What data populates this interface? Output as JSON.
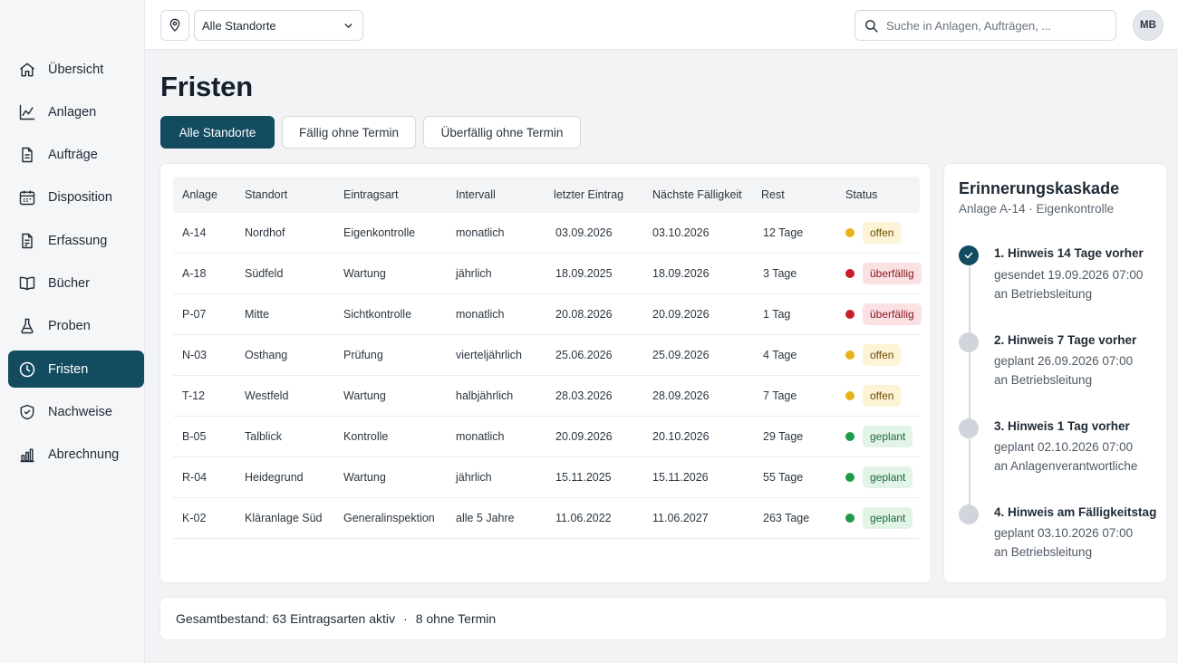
{
  "nav": {
    "items": [
      {
        "label": "Übersicht",
        "icon": "home-icon",
        "active": false
      },
      {
        "label": "Anlagen",
        "icon": "chart-line-icon",
        "active": false
      },
      {
        "label": "Aufträge",
        "icon": "document-icon",
        "active": false
      },
      {
        "label": "Disposition",
        "icon": "calendar-icon",
        "active": false
      },
      {
        "label": "Erfassung",
        "icon": "document-edit-icon",
        "active": false
      },
      {
        "label": "Bücher",
        "icon": "book-icon",
        "active": false
      },
      {
        "label": "Proben",
        "icon": "flask-icon",
        "active": false
      },
      {
        "label": "Fristen",
        "icon": "clock-icon",
        "active": true
      },
      {
        "label": "Nachweise",
        "icon": "shield-icon",
        "active": false
      },
      {
        "label": "Abrechnung",
        "icon": "bar-chart-icon",
        "active": false
      }
    ]
  },
  "topbar": {
    "location_value": "Alle Standorte",
    "search_placeholder": "Suche in Anlagen, Aufträgen, ...",
    "avatar_initials": "MB"
  },
  "page": {
    "title": "Fristen",
    "tabs": [
      {
        "label": "Alle Standorte",
        "active": true
      },
      {
        "label": "Fällig ohne Termin",
        "active": false
      },
      {
        "label": "Überfällig ohne Termin",
        "active": false
      }
    ]
  },
  "table": {
    "headers": [
      "Anlage",
      "Standort",
      "Eintragsart",
      "Intervall",
      "letzter Eintrag",
      "Nächste Fälligkeit",
      "Rest",
      "Status"
    ],
    "rows": [
      {
        "anlage": "A-14",
        "standort": "Nordhof",
        "eintragsart": "Eigenkontrolle",
        "intervall": "monatlich",
        "letzter": "03.09.2026",
        "naechste": "03.10.2026",
        "rest": "12 Tage",
        "status": "offen",
        "status_type": "open"
      },
      {
        "anlage": "A-18",
        "standort": "Südfeld",
        "eintragsart": "Wartung",
        "intervall": "jährlich",
        "letzter": "18.09.2025",
        "naechste": "18.09.2026",
        "rest": "3 Tage",
        "status": "überfällig",
        "status_type": "overdue"
      },
      {
        "anlage": "P-07",
        "standort": "Mitte",
        "eintragsart": "Sichtkontrolle",
        "intervall": "monatlich",
        "letzter": "20.08.2026",
        "naechste": "20.09.2026",
        "rest": "1 Tag",
        "status": "überfällig",
        "status_type": "overdue"
      },
      {
        "anlage": "N-03",
        "standort": "Osthang",
        "eintragsart": "Prüfung",
        "intervall": "vierteljährlich",
        "letzter": "25.06.2026",
        "naechste": "25.09.2026",
        "rest": "4 Tage",
        "status": "offen",
        "status_type": "open"
      },
      {
        "anlage": "T-12",
        "standort": "Westfeld",
        "eintragsart": "Wartung",
        "intervall": "halbjährlich",
        "letzter": "28.03.2026",
        "naechste": "28.09.2026",
        "rest": "7 Tage",
        "status": "offen",
        "status_type": "open"
      },
      {
        "anlage": "B-05",
        "standort": "Talblick",
        "eintragsart": "Kontrolle",
        "intervall": "monatlich",
        "letzter": "20.09.2026",
        "naechste": "20.10.2026",
        "rest": "29 Tage",
        "status": "geplant",
        "status_type": "planned"
      },
      {
        "anlage": "R-04",
        "standort": "Heidegrund",
        "eintragsart": "Wartung",
        "intervall": "jährlich",
        "letzter": "15.11.2025",
        "naechste": "15.11.2026",
        "rest": "55 Tage",
        "status": "geplant",
        "status_type": "planned"
      },
      {
        "anlage": "K-02",
        "standort": "Kläranlage Süd",
        "eintragsart": "Generalinspektion",
        "intervall": "alle 5 Jahre",
        "letzter": "11.06.2022",
        "naechste": "11.06.2027",
        "rest": "263 Tage",
        "status": "geplant",
        "status_type": "planned"
      }
    ]
  },
  "status_colors": {
    "open": {
      "dot": "#e8b21a",
      "bg": "#fdf3d6",
      "text": "#6b4e00"
    },
    "overdue": {
      "dot": "#c81e2c",
      "bg": "#fbe1e3",
      "text": "#8a1822"
    },
    "planned": {
      "dot": "#1f9a4a",
      "bg": "#e2f3e8",
      "text": "#1c6b3a"
    }
  },
  "panel": {
    "title": "Erinnerungskaskade",
    "subtitle": "Anlage A-14 · Eigenkontrolle",
    "steps": [
      {
        "title": "1. Hinweis 14 Tage vorher",
        "line1": "gesendet 19.09.2026 07:00",
        "line2": "an Betriebsleitung",
        "done": true
      },
      {
        "title": "2. Hinweis 7 Tage vorher",
        "line1": "geplant 26.09.2026 07:00",
        "line2": "an Betriebsleitung",
        "done": false
      },
      {
        "title": "3. Hinweis 1 Tag vorher",
        "line1": "geplant 02.10.2026 07:00",
        "line2": "an Anlagenverantwortliche",
        "done": false
      },
      {
        "title": "4. Hinweis am Fälligkeitstag",
        "line1": "geplant 03.10.2026 07:00",
        "line2": "an Betriebsleitung",
        "done": false
      }
    ]
  },
  "footer": {
    "total": "Gesamtbestand: 63 Eintragsarten aktiv",
    "separator": "·",
    "without_date": "8 ohne Termin"
  },
  "colors": {
    "accent": "#134c61"
  }
}
